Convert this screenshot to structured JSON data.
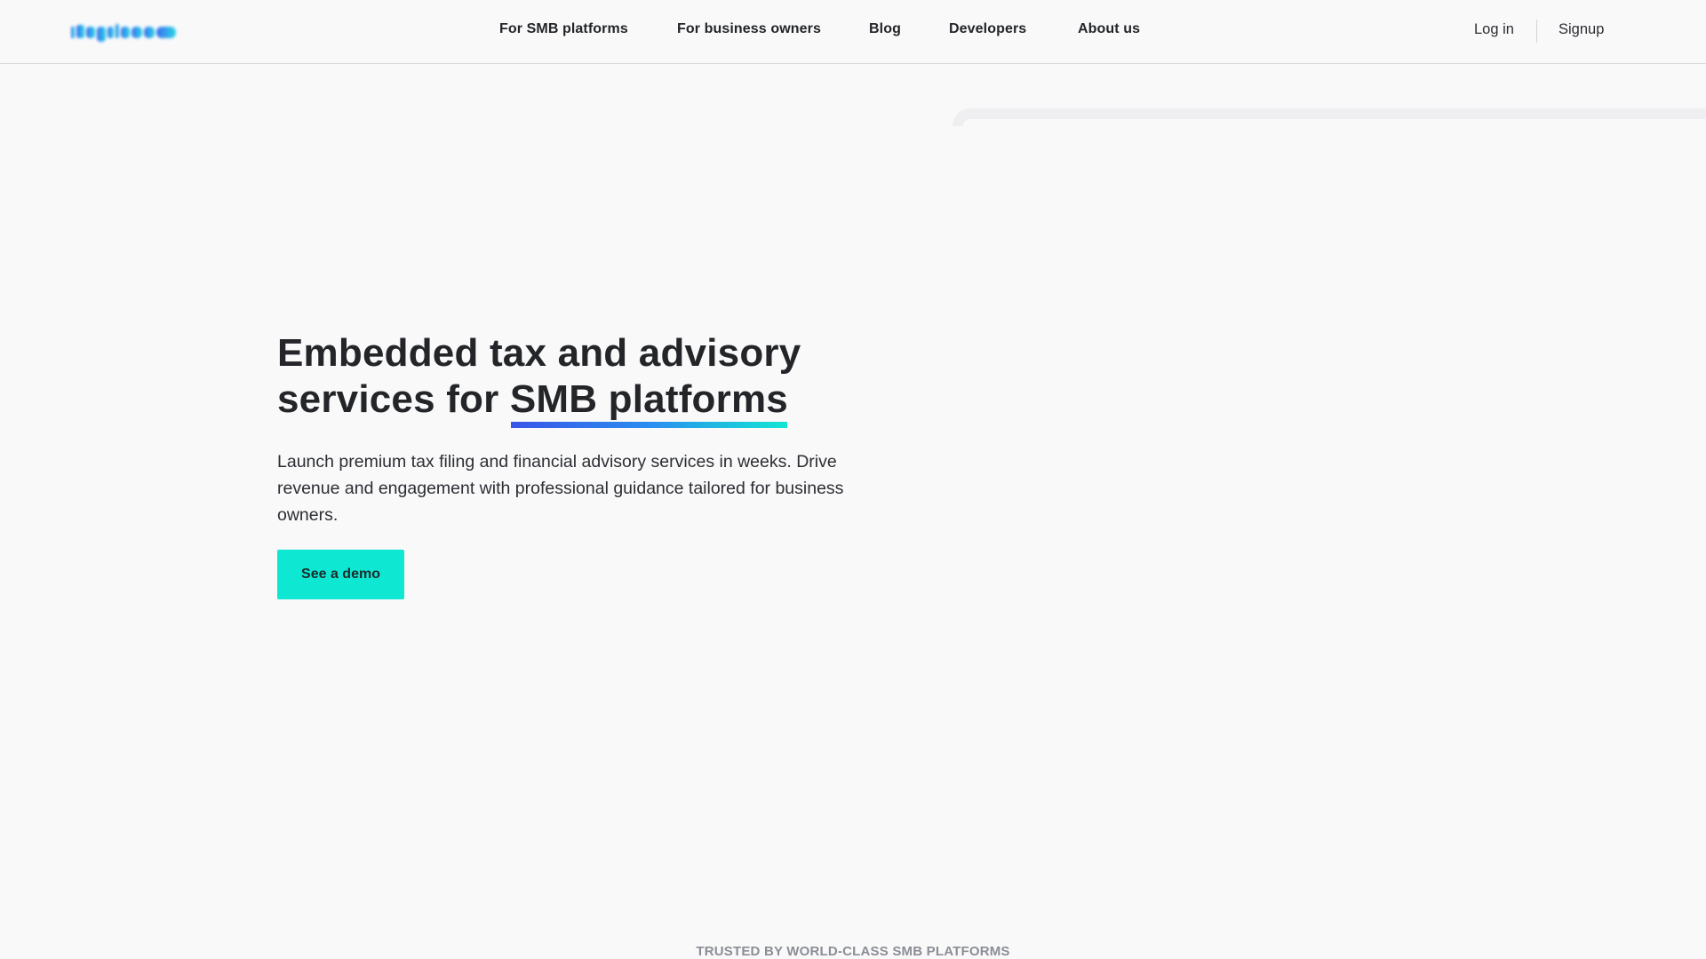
{
  "brand": {
    "logo_text": "Keypriso",
    "colors": {
      "accent_teal": "#0ee8d3",
      "accent_blue": "#3a55e8",
      "text_dark": "#232529",
      "background": "#f9f9fa"
    }
  },
  "header": {
    "nav": [
      {
        "label": "For SMB platforms"
      },
      {
        "label": "For business owners"
      },
      {
        "label": "Blog"
      },
      {
        "label": "Developers"
      },
      {
        "label": "About us"
      }
    ],
    "login_label": "Log in",
    "signup_label": "Signup"
  },
  "hero": {
    "title_prefix": "Embedded tax and advisory services for ",
    "title_accent": "SMB platforms",
    "subtitle": "Launch premium tax filing and financial advisory services in weeks. Drive revenue and engagement with professional guidance tailored for business owners.",
    "cta_label": "See a demo"
  },
  "trusted": {
    "label": "TRUSTED BY WORLD-CLASS SMB PLATFORMS"
  }
}
